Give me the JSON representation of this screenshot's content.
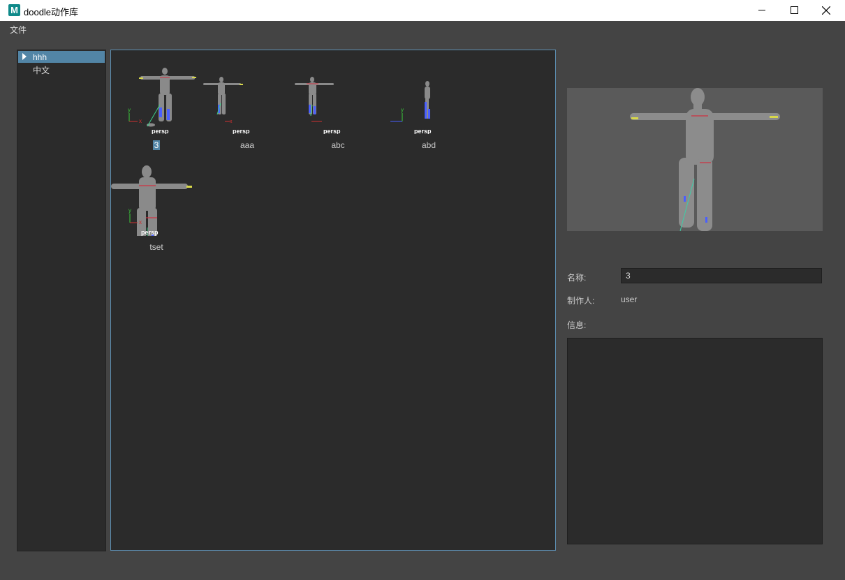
{
  "window": {
    "app_icon_letter": "M",
    "title": "doodle动作库",
    "controls": {
      "minimize": "minimize-icon",
      "maximize": "maximize-icon",
      "close": "close-icon"
    }
  },
  "menubar": {
    "file": "文件"
  },
  "tree": {
    "items": [
      {
        "label": "hhh",
        "selected": true,
        "expandable": true
      },
      {
        "label": "中文",
        "selected": false,
        "expandable": false
      }
    ]
  },
  "grid": {
    "thumbnail_overlay_text": "persp",
    "items": [
      {
        "name": "3",
        "selected": true
      },
      {
        "name": "aaa",
        "selected": false
      },
      {
        "name": "abc",
        "selected": false
      },
      {
        "name": "abd",
        "selected": false
      },
      {
        "name": "tset",
        "selected": false
      }
    ]
  },
  "details": {
    "name_label": "名称:",
    "name_value": "3",
    "author_label": "制作人:",
    "author_value": "user",
    "info_label": "信息:",
    "info_value": ""
  },
  "colors": {
    "background": "#444444",
    "panel": "#2b2b2b",
    "selection": "#5285a6",
    "focus_border": "#5d8fb3",
    "preview_bg": "#5a5a5a"
  }
}
